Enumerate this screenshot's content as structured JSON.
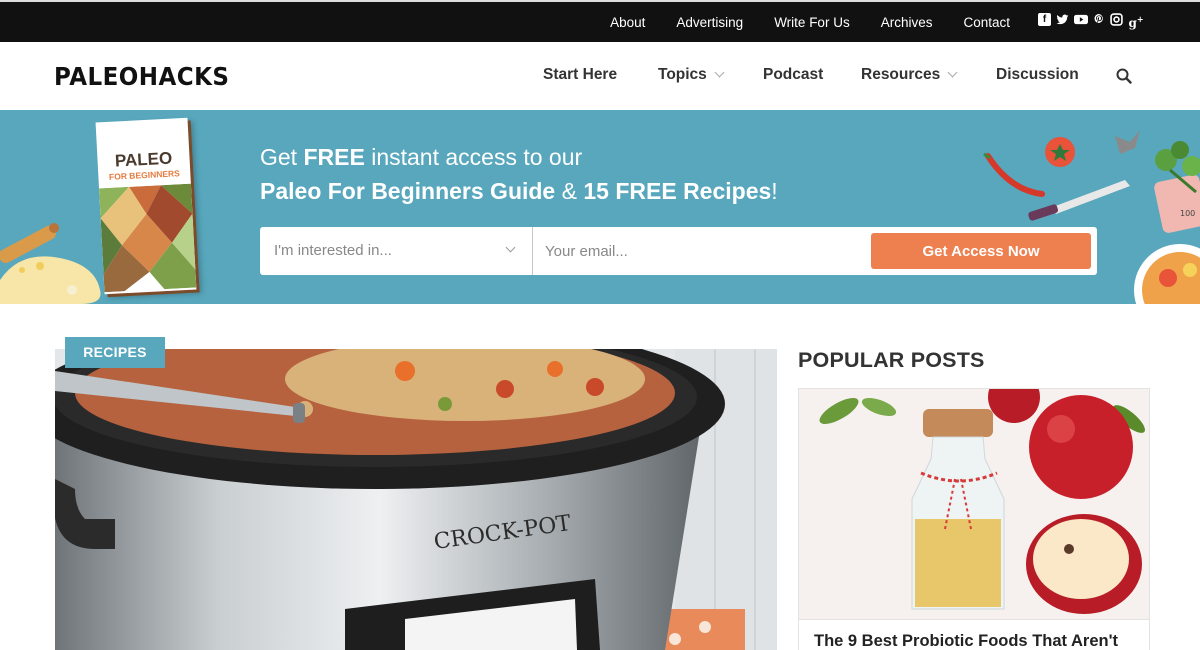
{
  "topbar": {
    "links": [
      "About",
      "Advertising",
      "Write For Us",
      "Archives",
      "Contact"
    ],
    "social_icons": [
      "facebook-icon",
      "twitter-icon",
      "youtube-icon",
      "pinterest-icon",
      "instagram-icon",
      "google-plus-icon"
    ]
  },
  "header": {
    "logo": "PALEOHACKS",
    "nav": [
      {
        "label": "Start Here",
        "dropdown": false
      },
      {
        "label": "Topics",
        "dropdown": true
      },
      {
        "label": "Podcast",
        "dropdown": false
      },
      {
        "label": "Resources",
        "dropdown": true
      },
      {
        "label": "Discussion",
        "dropdown": false
      }
    ],
    "search_icon": "search-icon"
  },
  "banner": {
    "line1_pre": "Get ",
    "line1_bold": "FREE",
    "line1_post": " instant access to our",
    "line2_bold1": "Paleo For Beginners Guide",
    "line2_mid": " & ",
    "line2_bold2": "15 FREE Recipes",
    "line2_end": "!",
    "book": {
      "title": "PALEO",
      "subtitle": "FOR BEGINNERS"
    },
    "select_placeholder": "I'm interested in...",
    "email_placeholder": "Your email...",
    "cta_label": "Get Access Now"
  },
  "article": {
    "tag": "RECIPES",
    "image_text": "CROCK-POT"
  },
  "sidebar": {
    "title": "POPULAR POSTS",
    "posts": [
      {
        "title": "The 9 Best Probiotic Foods That Aren't"
      }
    ]
  },
  "colors": {
    "topbar": "#111111",
    "banner": "#58a7bd",
    "cta": "#ee7f4f",
    "tag": "#58a7bd"
  }
}
